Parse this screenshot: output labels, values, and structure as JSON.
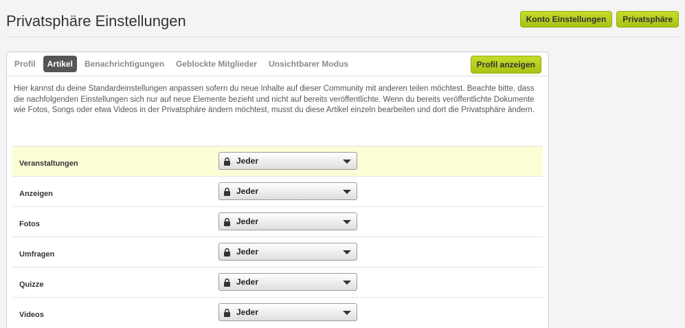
{
  "header": {
    "title": "Privatsphäre Einstellungen",
    "buttons": [
      "Konto Einstellungen",
      "Privatsphäre"
    ]
  },
  "tabs": [
    "Profil",
    "Artikel",
    "Benachrichtigungen",
    "Geblockte Mitglieder",
    "Unsichtbarer Modus"
  ],
  "active_tab": "Artikel",
  "profile_button": "Profil anzeigen",
  "intro": "Hier kannst du deine Standardeinstellungen anpassen sofern du neue Inhalte auf dieser Community mit anderen teilen möchtest. Beachte bitte, dass die nachfolgenden Einstellungen sich nur auf neue Elemente bezieht und nicht auf bereits veröffentlichte. Wenn du bereits veröffentlichte Dokumente wie Fotos, Songs oder etwa Videos in der Privatsphäre ändern möchtest, musst du diese Artikel einzeln bearbeiten und dort die Privatsphäre ändern.",
  "settings": [
    {
      "label": "Veranstaltungen",
      "value": "Jeder",
      "highlighted": true
    },
    {
      "label": "Anzeigen",
      "value": "Jeder",
      "highlighted": false
    },
    {
      "label": "Fotos",
      "value": "Jeder",
      "highlighted": false
    },
    {
      "label": "Umfragen",
      "value": "Jeder",
      "highlighted": false
    },
    {
      "label": "Quizze",
      "value": "Jeder",
      "highlighted": false
    },
    {
      "label": "Videos",
      "value": "Jeder",
      "highlighted": false
    }
  ],
  "colors": {
    "accent": "#b5cd1c",
    "active_tab": "#555555",
    "highlight_row": "#fdfdd6"
  },
  "icons": {
    "select_prefix": "lock-icon",
    "select_suffix": "caret-down-icon"
  }
}
